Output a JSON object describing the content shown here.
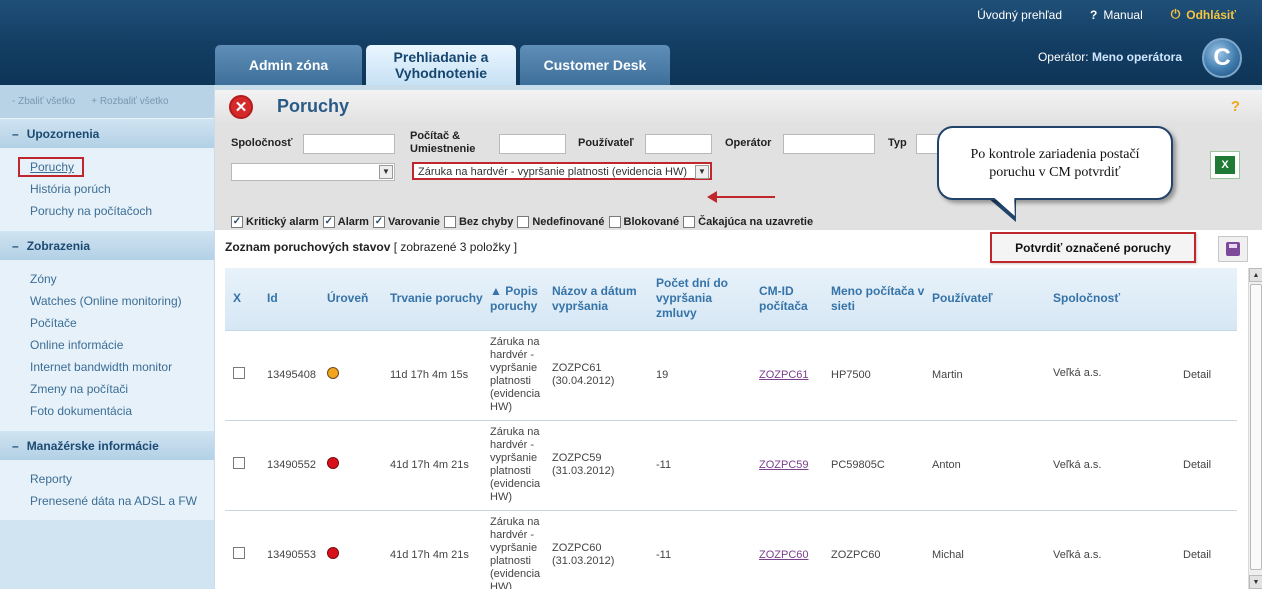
{
  "top_links": {
    "overview": "Úvodný prehľad",
    "manual": "Manual",
    "logout": "Odhlásiť"
  },
  "tabs": [
    {
      "label": "Admin zóna"
    },
    {
      "label": "Prehliadanie a Vyhodnotenie"
    },
    {
      "label": "Customer Desk"
    }
  ],
  "operator": {
    "label": "Operátor:",
    "name": "Meno operátora"
  },
  "logo_letter": "C",
  "sidebar": {
    "collapse_all": "- Zbaliť všetko",
    "expand_all": "+ Rozbaliť všetko",
    "sections": [
      {
        "title": "Upozornenia",
        "items": [
          "Poruchy",
          "História porúch",
          "Poruchy na počítačoch"
        ]
      },
      {
        "title": "Zobrazenia",
        "items": [
          "Zóny",
          "Watches (Online monitoring)",
          "Počítače",
          "Online informácie",
          "Internet bandwidth monitor",
          "Zmeny na počítači",
          "Foto dokumentácia"
        ]
      },
      {
        "title": "Manažérske informácie",
        "items": [
          "Reporty",
          "Prenesené dáta na ADSL a FW"
        ]
      }
    ]
  },
  "page": {
    "title": "Poruchy",
    "help": "?"
  },
  "filters": {
    "company": "Spoločnosť",
    "computer_line1": "Počítač &",
    "computer_line2": "Umiestnenie",
    "user": "Používateľ",
    "operator": "Operátor",
    "type": "Typ",
    "type_select_value": "Záruka na hardvér - vypršanie platnosti (evidencia HW)",
    "checkboxes": [
      {
        "label": "Kritický alarm",
        "checked": true
      },
      {
        "label": "Alarm",
        "checked": true
      },
      {
        "label": "Varovanie",
        "checked": true
      },
      {
        "label": "Bez chyby",
        "checked": false
      },
      {
        "label": "Nedefinované",
        "checked": false
      },
      {
        "label": "Blokované",
        "checked": false
      },
      {
        "label": "Čakajúca na uzavretie",
        "checked": false
      }
    ]
  },
  "callout": {
    "text": "Po kontrole zariadenia postačí poruchu v CM potvrdiť"
  },
  "list": {
    "title": "Zoznam poruchových stavov",
    "count": "[ zobrazené 3 položky ]",
    "confirm_button": "Potvrdiť označené poruchy"
  },
  "table": {
    "headers": {
      "x": "X",
      "id": "Id",
      "level": "Úroveň",
      "duration": "Trvanie poruchy",
      "desc": "▲ Popis poruchy",
      "name_date": "Názov a dátum vypršania",
      "days": "Počet dní do vypršania zmluvy",
      "cmid": "CM-ID počítača",
      "pcname": "Meno počítača v sieti",
      "user": "Používateľ",
      "company": "Spoločnosť",
      "detail": ""
    },
    "rows": [
      {
        "id": "13495408",
        "level": "orange",
        "duration": "11d 17h 4m 15s",
        "desc": "Záruka na hardvér - vypršanie platnosti (evidencia HW)",
        "name": "ZOZPC61",
        "date": "(30.04.2012)",
        "days": "19",
        "cmid": "ZOZPC61",
        "pcname": "HP7500",
        "user": "Martin",
        "company": "Veľká a.s.",
        "detail": "Detail"
      },
      {
        "id": "13490552",
        "level": "red",
        "duration": "41d 17h 4m 21s",
        "desc": "Záruka na hardvér - vypršanie platnosti (evidencia HW)",
        "name": "ZOZPC59",
        "date": "(31.03.2012)",
        "days": "-11",
        "cmid": "ZOZPC59",
        "pcname": "PC59805C",
        "user": "Anton",
        "company": "Veľká a.s.",
        "detail": "Detail"
      },
      {
        "id": "13490553",
        "level": "red",
        "duration": "41d 17h 4m 21s",
        "desc": "Záruka na hardvér - vypršanie platnosti (evidencia HW)",
        "name": "ZOZPC60",
        "date": "(31.03.2012)",
        "days": "-11",
        "cmid": "ZOZPC60",
        "pcname": "ZOZPC60",
        "user": "Michal",
        "company": "Veľká a.s.",
        "detail": "Detail"
      }
    ]
  },
  "colors": {
    "header_bg": "#133d63",
    "accent": "#2a5a88",
    "alert_red": "#c0272d",
    "orange": "#f3a51e"
  }
}
